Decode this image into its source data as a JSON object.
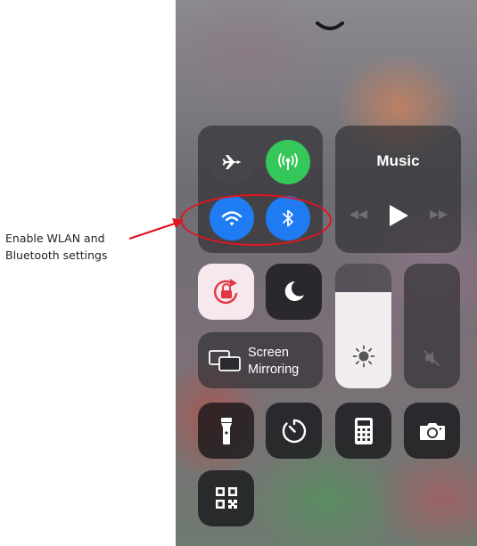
{
  "annotation": {
    "line1": "Enable WLAN and",
    "line2": "Bluetooth settings"
  },
  "colors": {
    "annotation_red": "#e0141e",
    "cellular_green": "#35c759",
    "toggle_blue": "#1f7cf2",
    "tile_dark": "#28282c"
  },
  "control_center": {
    "connectivity": {
      "airplane_mode": {
        "icon": "airplane-icon",
        "on": false
      },
      "cellular_data": {
        "icon": "cellular-antenna-icon",
        "on": true
      },
      "wlan": {
        "icon": "wifi-icon",
        "on": true
      },
      "bluetooth": {
        "icon": "bluetooth-icon",
        "on": true
      }
    },
    "music": {
      "title": "Music",
      "controls": [
        "rewind-icon",
        "play-icon",
        "fast-forward-icon"
      ]
    },
    "orientation_lock": {
      "icon": "rotation-lock-icon",
      "on": true
    },
    "do_not_disturb": {
      "icon": "moon-icon",
      "on": false
    },
    "screen_mirroring": {
      "line1": "Screen",
      "line2": "Mirroring",
      "icon": "screen-mirroring-icon"
    },
    "brightness": {
      "icon": "sun-icon",
      "level": 0.6
    },
    "volume": {
      "icon": "speaker-muted-icon",
      "level": 0.0
    },
    "shortcuts": [
      "flashlight-icon",
      "timer-icon",
      "calculator-icon",
      "camera-icon",
      "qr-code-icon"
    ]
  }
}
